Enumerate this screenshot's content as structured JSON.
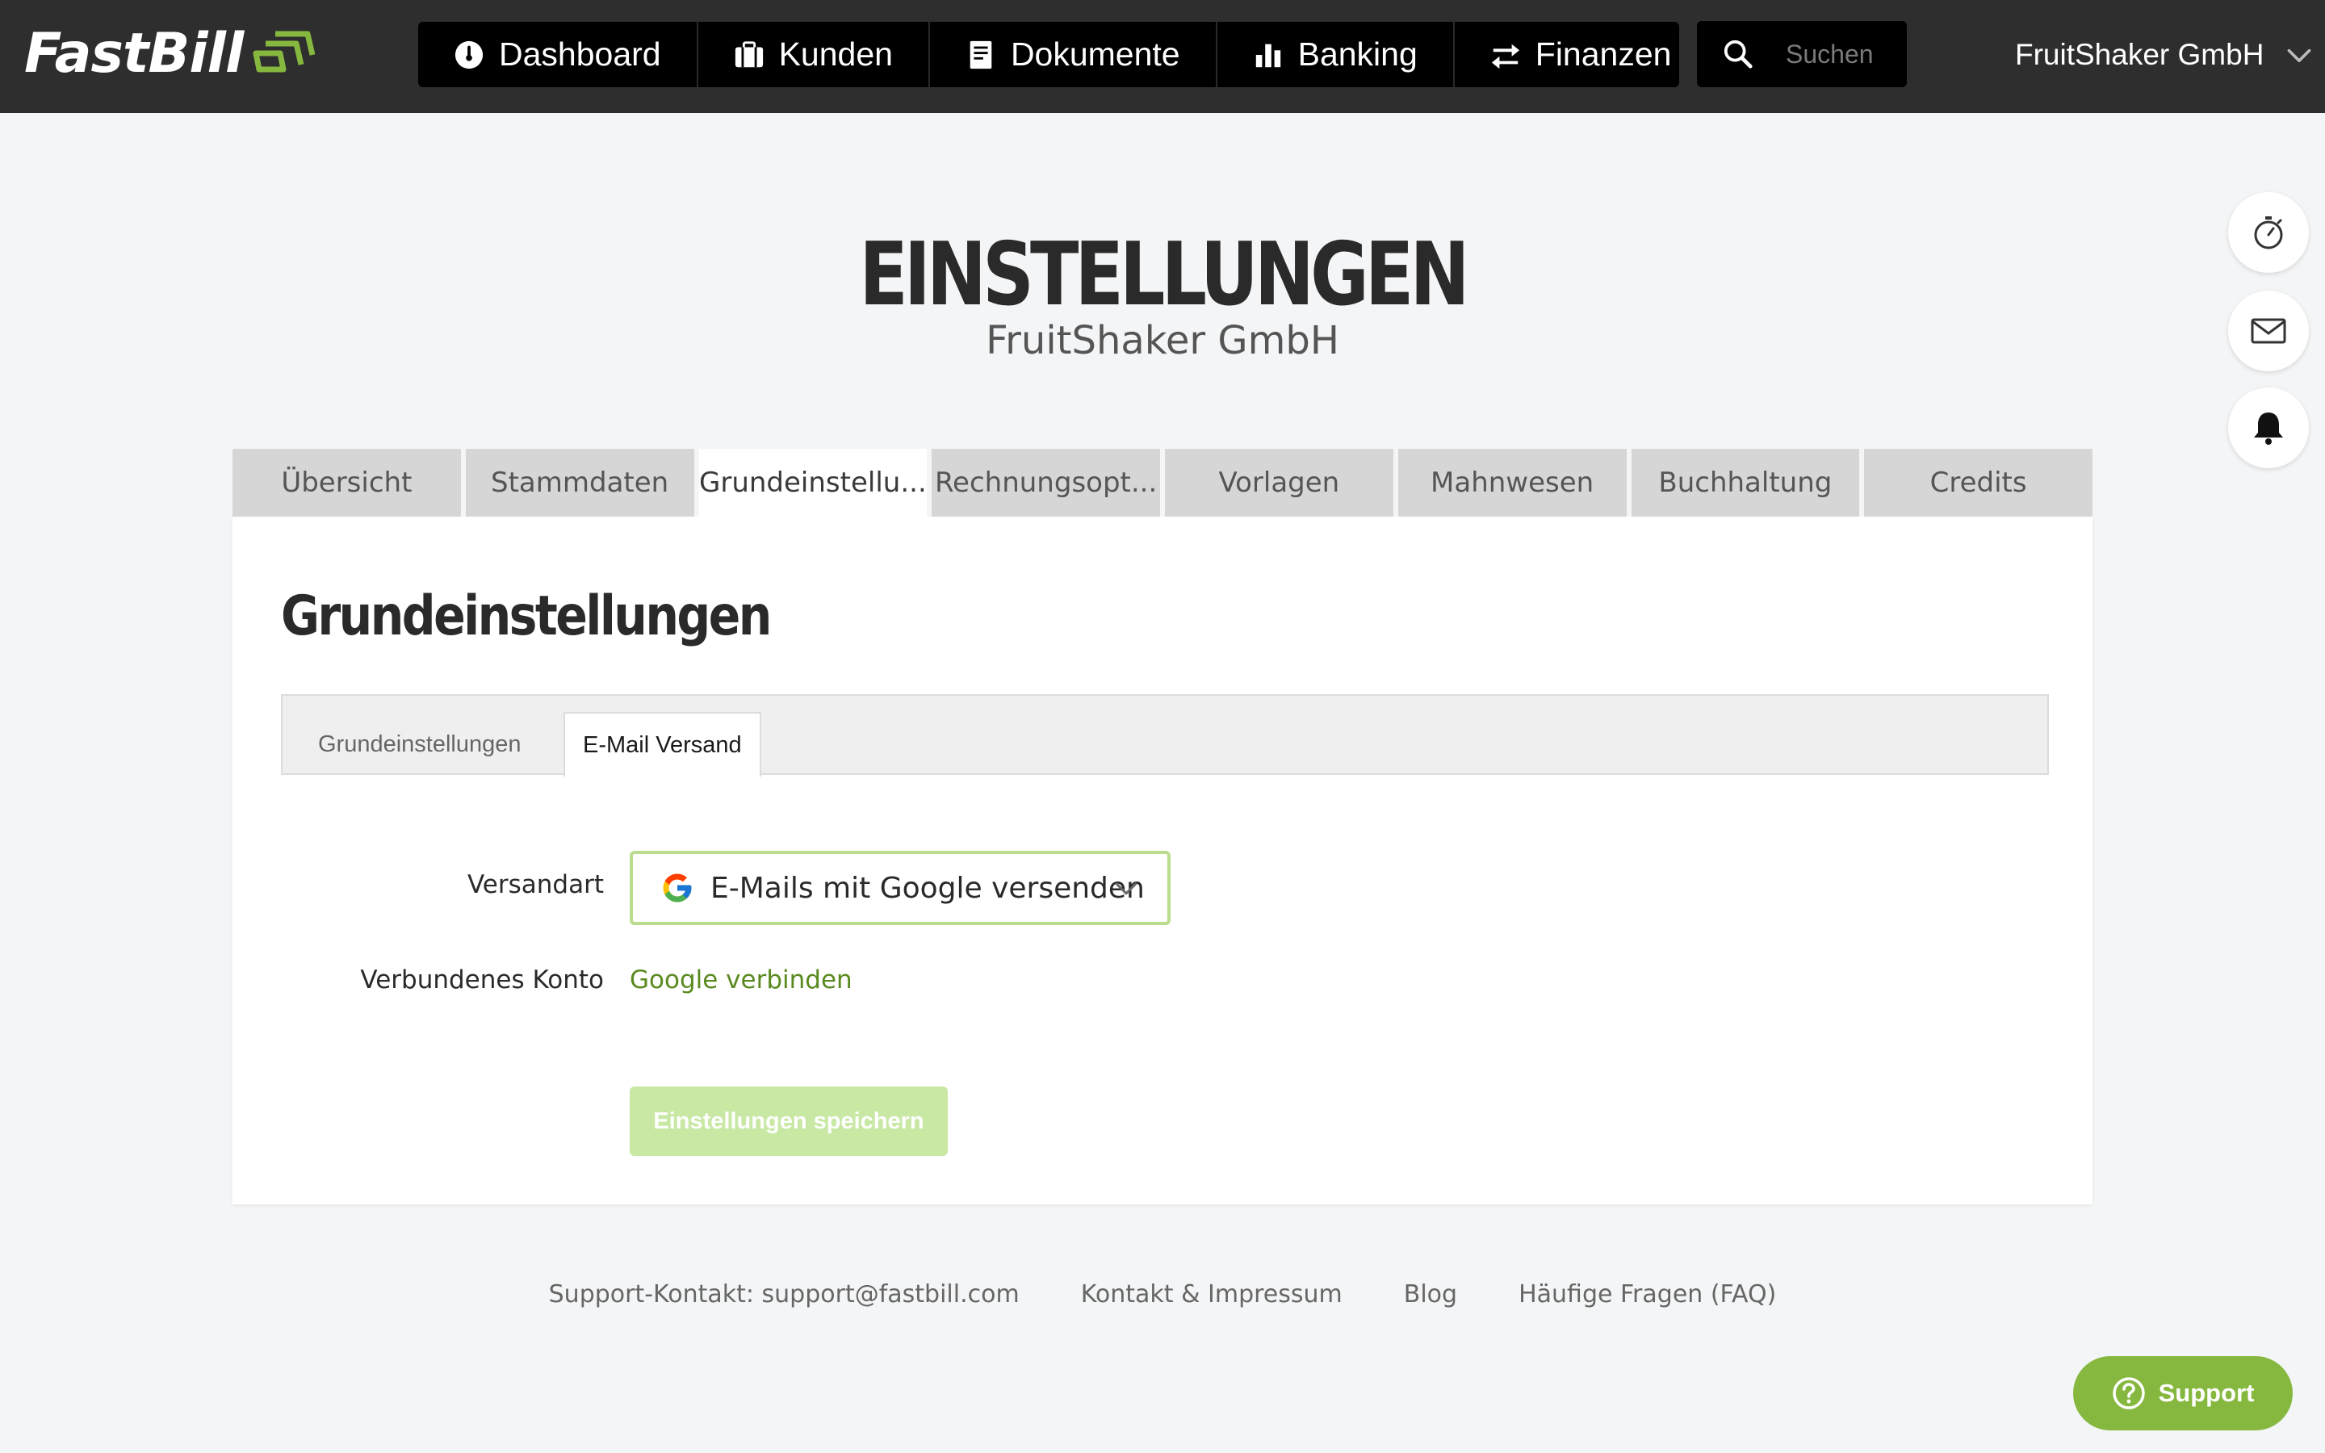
{
  "header": {
    "logo_text": "FastBill",
    "nav": [
      {
        "label": "Dashboard",
        "icon": "speedometer-icon"
      },
      {
        "label": "Kunden",
        "icon": "briefcase-icon"
      },
      {
        "label": "Dokumente",
        "icon": "document-icon"
      },
      {
        "label": "Banking",
        "icon": "bar-chart-icon"
      },
      {
        "label": "Finanzen",
        "icon": "transfer-arrows-icon"
      }
    ],
    "search_placeholder": "Suchen",
    "account_name": "FruitShaker GmbH"
  },
  "side_actions": [
    "stopwatch-icon",
    "mail-icon",
    "bell-icon"
  ],
  "page": {
    "title": "EINSTELLUNGEN",
    "subtitle": "FruitShaker GmbH"
  },
  "tabs": [
    {
      "label": "Übersicht",
      "active": false
    },
    {
      "label": "Stammdaten",
      "active": false
    },
    {
      "label": "Grundeinstellu...",
      "active": true
    },
    {
      "label": "Rechnungsopt...",
      "active": false
    },
    {
      "label": "Vorlagen",
      "active": false
    },
    {
      "label": "Mahnwesen",
      "active": false
    },
    {
      "label": "Buchhaltung",
      "active": false
    },
    {
      "label": "Credits",
      "active": false
    }
  ],
  "card": {
    "title": "Grundeinstellungen",
    "subtabs": [
      {
        "label": "Grundeinstellungen",
        "active": false
      },
      {
        "label": "E-Mail Versand",
        "active": true
      }
    ],
    "form": {
      "versandart_label": "Versandart",
      "versandart_value": "E-Mails mit Google versenden",
      "konto_label": "Verbundenes Konto",
      "konto_link": "Google verbinden",
      "save_label": "Einstellungen speichern"
    }
  },
  "footer": {
    "links": [
      "Support-Kontakt: support@fastbill.com",
      "Kontakt & Impressum",
      "Blog",
      "Häufige Fragen (FAQ)"
    ]
  },
  "support_button": "Support",
  "colors": {
    "topbar": "#2e2e2e",
    "brand_green": "#86b83f",
    "link_green": "#5a8a1f",
    "save_disabled": "#c8e8a4"
  }
}
